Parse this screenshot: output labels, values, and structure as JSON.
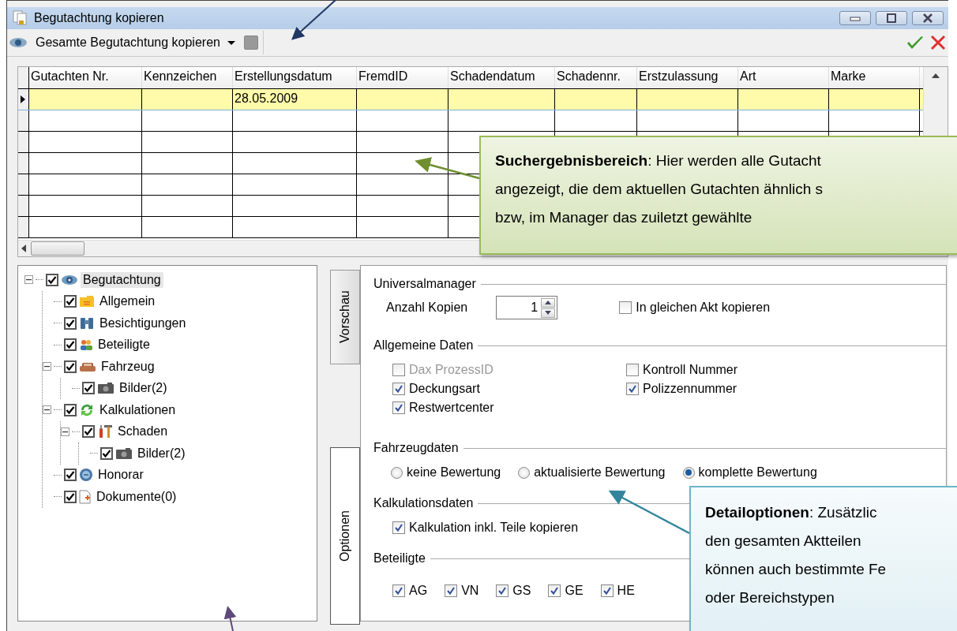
{
  "window": {
    "title": "Begutachtung kopieren"
  },
  "toolbar": {
    "mode": "Gesamte Begutachtung kopieren"
  },
  "grid": {
    "columns": [
      "Gutachten Nr.",
      "Kennzeichen",
      "Erstellungsdatum",
      "FremdID",
      "Schadendatum",
      "Schadennr.",
      "Erstzulassung",
      "Art",
      "Marke"
    ],
    "rows": [
      {
        "selected": true,
        "cells": [
          "",
          "",
          "28.05.2009",
          "",
          "",
          "",
          "",
          "",
          ""
        ]
      },
      {
        "selected": false,
        "cells": [
          "",
          "",
          "",
          "",
          "",
          "",
          "",
          "",
          ""
        ]
      },
      {
        "selected": false,
        "cells": [
          "",
          "",
          "",
          "",
          "",
          "",
          "",
          "",
          ""
        ]
      },
      {
        "selected": false,
        "cells": [
          "",
          "",
          "",
          "",
          "",
          "",
          "",
          "",
          ""
        ]
      },
      {
        "selected": false,
        "cells": [
          "",
          "",
          "",
          "",
          "",
          "",
          "",
          "",
          ""
        ]
      },
      {
        "selected": false,
        "cells": [
          "",
          "",
          "",
          "",
          "",
          "",
          "",
          "",
          ""
        ]
      },
      {
        "selected": false,
        "cells": [
          "",
          "",
          "",
          "",
          "",
          "",
          "",
          "",
          ""
        ]
      }
    ]
  },
  "tree": [
    {
      "label": "Begutachtung",
      "kind": "eye",
      "checked": true,
      "selected": true,
      "expanded": true,
      "children": [
        {
          "label": "Allgemein",
          "kind": "folder",
          "checked": true,
          "selected": false
        },
        {
          "label": "Besichtigungen",
          "kind": "binoculars",
          "checked": true,
          "selected": false
        },
        {
          "label": "Beteiligte",
          "kind": "people",
          "checked": true,
          "selected": false
        },
        {
          "label": "Fahrzeug",
          "kind": "car",
          "checked": true,
          "selected": false,
          "expanded": true,
          "children": [
            {
              "label": "Bilder(2)",
              "kind": "camera",
              "checked": true,
              "selected": false
            }
          ]
        },
        {
          "label": "Kalkulationen",
          "kind": "cycle",
          "checked": true,
          "selected": false,
          "expanded": true,
          "children": [
            {
              "label": "Schaden",
              "kind": "tools",
              "checked": true,
              "selected": false,
              "expanded": true,
              "children": [
                {
                  "label": "Bilder(2)",
                  "kind": "camera",
                  "checked": true,
                  "selected": false
                }
              ]
            }
          ]
        },
        {
          "label": "Honorar",
          "kind": "coin",
          "checked": true,
          "selected": false
        },
        {
          "label": "Dokumente(0)",
          "kind": "document",
          "checked": true,
          "selected": false
        }
      ]
    }
  ],
  "tabs": [
    {
      "label": "Vorschau",
      "selected": false
    },
    {
      "label": "Optionen",
      "selected": true
    }
  ],
  "universal": {
    "title": "Universalmanager",
    "copies_label": "Anzahl Kopien",
    "copies_value": "1",
    "same_act": {
      "label": "In gleichen Akt kopieren",
      "checked": false
    }
  },
  "general": {
    "title": "Allgemeine Daten",
    "items": [
      {
        "label": "Dax ProzessID",
        "checked": false,
        "disabled": true
      },
      {
        "label": "Kontroll Nummer",
        "checked": false,
        "disabled": false
      },
      {
        "label": "Deckungsart",
        "checked": true,
        "disabled": false
      },
      {
        "label": "Polizzennummer",
        "checked": true,
        "disabled": false
      },
      {
        "label": "Restwertcenter",
        "checked": true,
        "disabled": false
      }
    ]
  },
  "vehicle": {
    "title": "Fahrzeugdaten",
    "options": [
      {
        "label": "keine Bewertung",
        "selected": false
      },
      {
        "label": "aktualisierte Bewertung",
        "selected": false
      },
      {
        "label": "komplette Bewertung",
        "selected": true
      }
    ]
  },
  "calc": {
    "title": "Kalkulationsdaten",
    "items": [
      {
        "label": "Kalkulation inkl. Teile kopieren",
        "checked": true
      }
    ]
  },
  "parties": {
    "title": "Beteiligte",
    "items": [
      {
        "label": "AG",
        "checked": true
      },
      {
        "label": "VN",
        "checked": true
      },
      {
        "label": "GS",
        "checked": true
      },
      {
        "label": "GE",
        "checked": true
      },
      {
        "label": "HE",
        "checked": true
      }
    ]
  },
  "callouts": [
    {
      "kind": "green",
      "lines": [
        "**Suchergebnisbereich**: Hier werden alle Gutacht",
        "angezeigt, die dem aktuellen Gutachten ähnlich s",
        "bzw, im Manager das zuiletzt gewählte"
      ]
    },
    {
      "kind": "blue",
      "lines": [
        "**Detailoptionen**: Zusätzlic",
        "den gesamten Aktteilen",
        "können auch bestimmte Fe",
        "oder Bereichstypen"
      ]
    }
  ]
}
